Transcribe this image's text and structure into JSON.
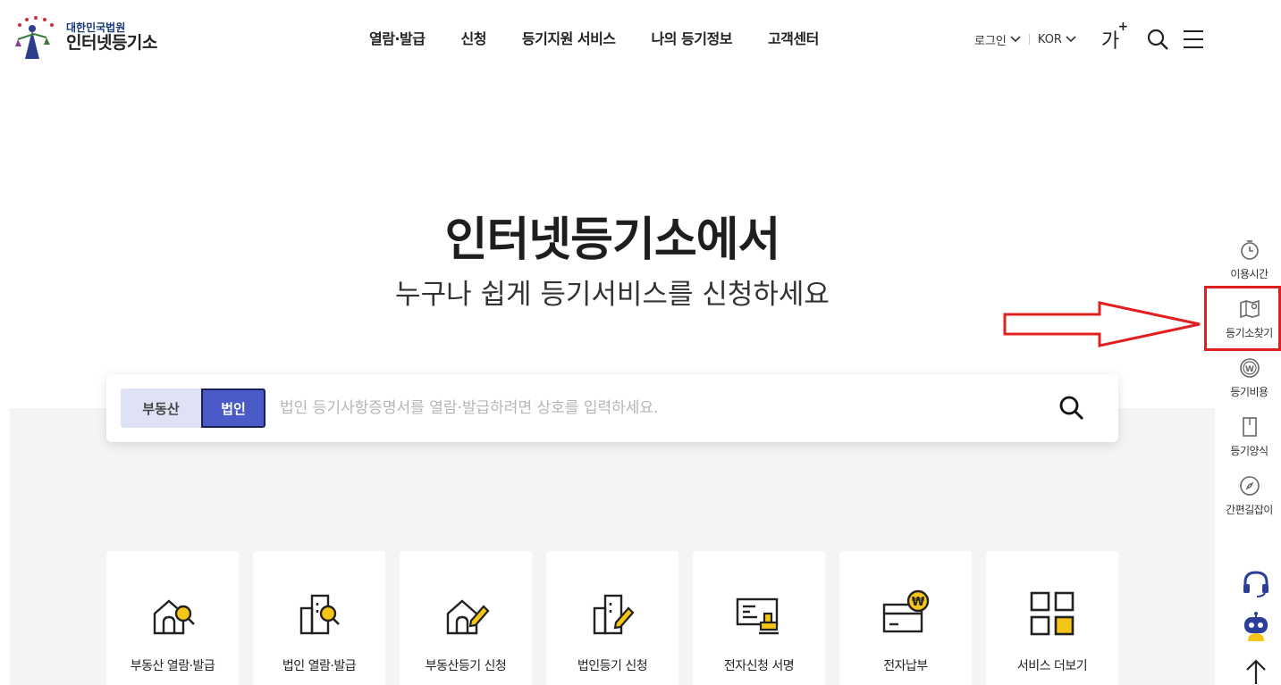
{
  "header": {
    "logo_sub": "대한민국법원",
    "logo_main": "인터넷등기소",
    "nav": [
      "열람·발급",
      "신청",
      "등기지원 서비스",
      "나의 등기정보",
      "고객센터"
    ],
    "login": "로그인",
    "language": "KOR",
    "font_size_label": "가",
    "font_size_plus": "+"
  },
  "hero": {
    "title": "인터넷등기소에서",
    "subtitle": "누구나 쉽게 등기서비스를 신청하세요"
  },
  "search": {
    "tabs": [
      "부동산",
      "법인"
    ],
    "active_tab": "법인",
    "placeholder": "법인 등기사항증명서를 열람·발급하려면 상호를 입력하세요."
  },
  "services": [
    {
      "label": "부동산 열람·발급",
      "icon": "house-search-icon"
    },
    {
      "label": "법인 열람·발급",
      "icon": "building-search-icon"
    },
    {
      "label": "부동산등기 신청",
      "icon": "house-pen-icon"
    },
    {
      "label": "법인등기 신청",
      "icon": "building-pen-icon"
    },
    {
      "label": "전자신청 서명",
      "icon": "document-stamp-icon"
    },
    {
      "label": "전자납부",
      "icon": "card-won-icon"
    },
    {
      "label": "서비스 더보기",
      "icon": "grid-icon"
    }
  ],
  "quick_menu": [
    {
      "label": "이용시간",
      "icon": "clock-icon"
    },
    {
      "label": "등기소찾기",
      "icon": "map-icon"
    },
    {
      "label": "등기비용",
      "icon": "won-coin-icon"
    },
    {
      "label": "등기양식",
      "icon": "form-book-icon"
    },
    {
      "label": "간편길잡이",
      "icon": "compass-icon"
    }
  ],
  "colors": {
    "accent": "#4a5bc8",
    "highlight": "#e02020",
    "icon_yellow": "#f5c518"
  }
}
